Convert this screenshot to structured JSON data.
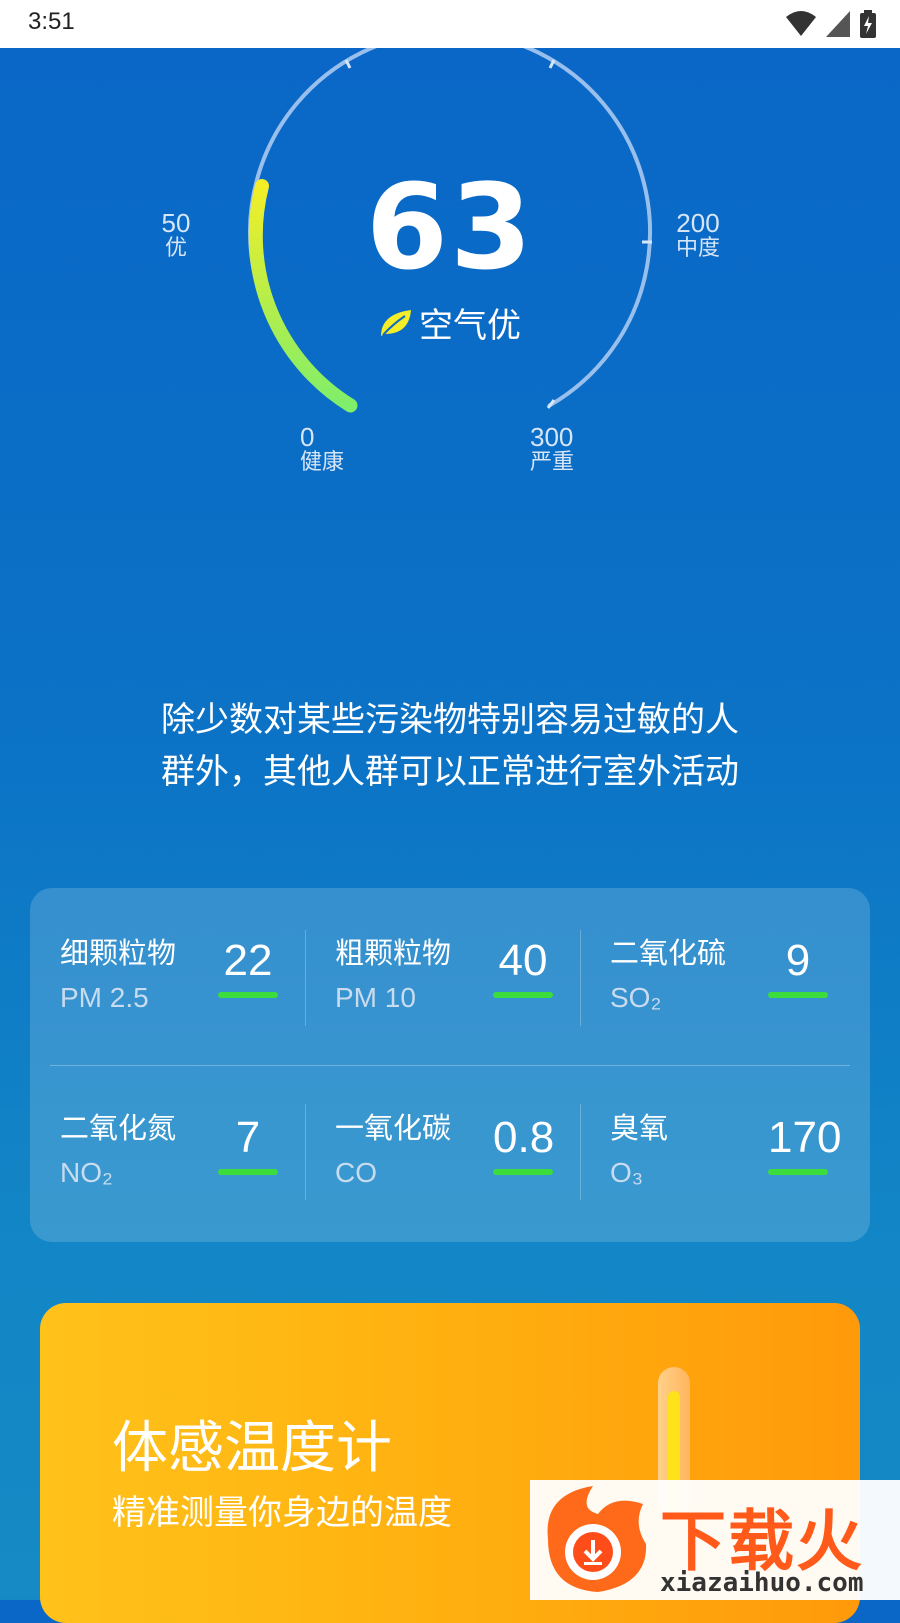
{
  "status_bar": {
    "time": "3:51",
    "icons": [
      "wifi-icon",
      "signal-icon",
      "battery-icon"
    ]
  },
  "gauge": {
    "aqi": "63",
    "level": "空气优",
    "level_icon": "leaf-icon",
    "scale_min": 0,
    "scale_max": 300,
    "ticks": [
      {
        "value": "0",
        "label": "健康"
      },
      {
        "value": "50",
        "label": "优"
      },
      {
        "value": "200",
        "label": "中度"
      },
      {
        "value": "300",
        "label": "严重"
      }
    ],
    "colors": {
      "fill_start": "#7fee6a",
      "fill_end": "#f3ee27",
      "track": "#a9c9f0"
    }
  },
  "advice": {
    "line1": "除少数对某些污染物特别容易过敏的人",
    "line2": "群外，其他人群可以正常进行室外活动"
  },
  "pollutants": [
    {
      "name": "细颗粒物",
      "code": "PM 2.5",
      "value": "22"
    },
    {
      "name": "粗颗粒物",
      "code": "PM 10",
      "value": "40"
    },
    {
      "name": "二氧化硫",
      "code": "SO₂",
      "value": "9"
    },
    {
      "name": "二氧化氮",
      "code": "NO₂",
      "value": "7"
    },
    {
      "name": "一氧化碳",
      "code": "CO",
      "value": "0.8"
    },
    {
      "name": "臭氧",
      "code": "O₃",
      "value": "170"
    }
  ],
  "promo": {
    "title": "体感温度计",
    "subtitle": "精准测量你身边的温度",
    "icon": "thermometer-icon"
  },
  "watermark": {
    "brand": "下载火",
    "url": "xiazaihuo.com"
  }
}
